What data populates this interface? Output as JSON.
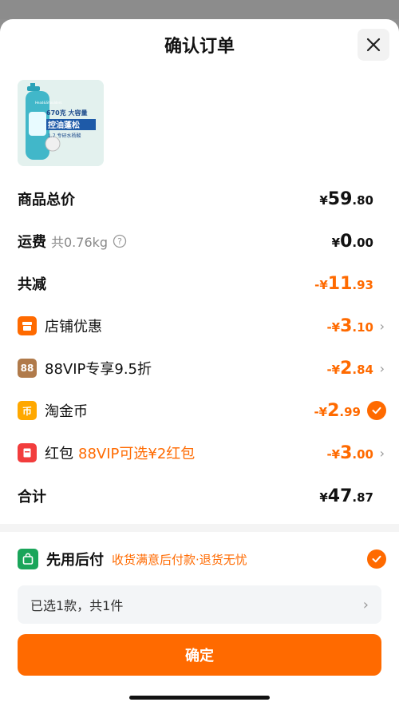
{
  "header": {
    "title": "确认订单"
  },
  "product": {
    "badge_line1": "670克 大容量",
    "badge_line2": "控油蓬松",
    "badge_line3": "1.7",
    "badge_line3_suffix": "专研水杨酸",
    "brand": "Head&Shoulders"
  },
  "summary": {
    "goods_total": {
      "label": "商品总价",
      "yen": "¥",
      "int": "59",
      "dec": ".80"
    },
    "shipping": {
      "label": "运费",
      "weight": "共0.76kg",
      "yen": "¥",
      "int": "0",
      "dec": ".00"
    },
    "discount_total": {
      "label": "共减",
      "yen": "-¥",
      "int": "11",
      "dec": ".93"
    },
    "discounts": [
      {
        "label": "店铺优惠",
        "icon": "store-icon",
        "color": "#ff6a00",
        "yen": "-¥",
        "int": "3",
        "dec": ".10"
      },
      {
        "label": "88VIP专享9.5折",
        "icon": "vip88-icon",
        "icon_text": "88",
        "color": "#b07a4a",
        "yen": "-¥",
        "int": "2",
        "dec": ".84"
      },
      {
        "label": "淘金币",
        "icon": "coin-icon",
        "icon_text": "币",
        "color": "#ffa800",
        "yen": "-¥",
        "int": "2",
        "dec": ".99"
      },
      {
        "label": "红包",
        "promo": "88VIP可选¥2红包",
        "icon": "red-packet-icon",
        "color": "#f23d3d",
        "yen": "-¥",
        "int": "3",
        "dec": ".00"
      }
    ],
    "total": {
      "label": "合计",
      "yen": "¥",
      "int": "47",
      "dec": ".87"
    }
  },
  "payment": {
    "label": "先用后付",
    "tag": "收货满意后付款·退货无忧"
  },
  "selection": {
    "text": "已选1款，共1件"
  },
  "actions": {
    "confirm": "确定"
  },
  "colors": {
    "accent": "#ff6a00"
  }
}
